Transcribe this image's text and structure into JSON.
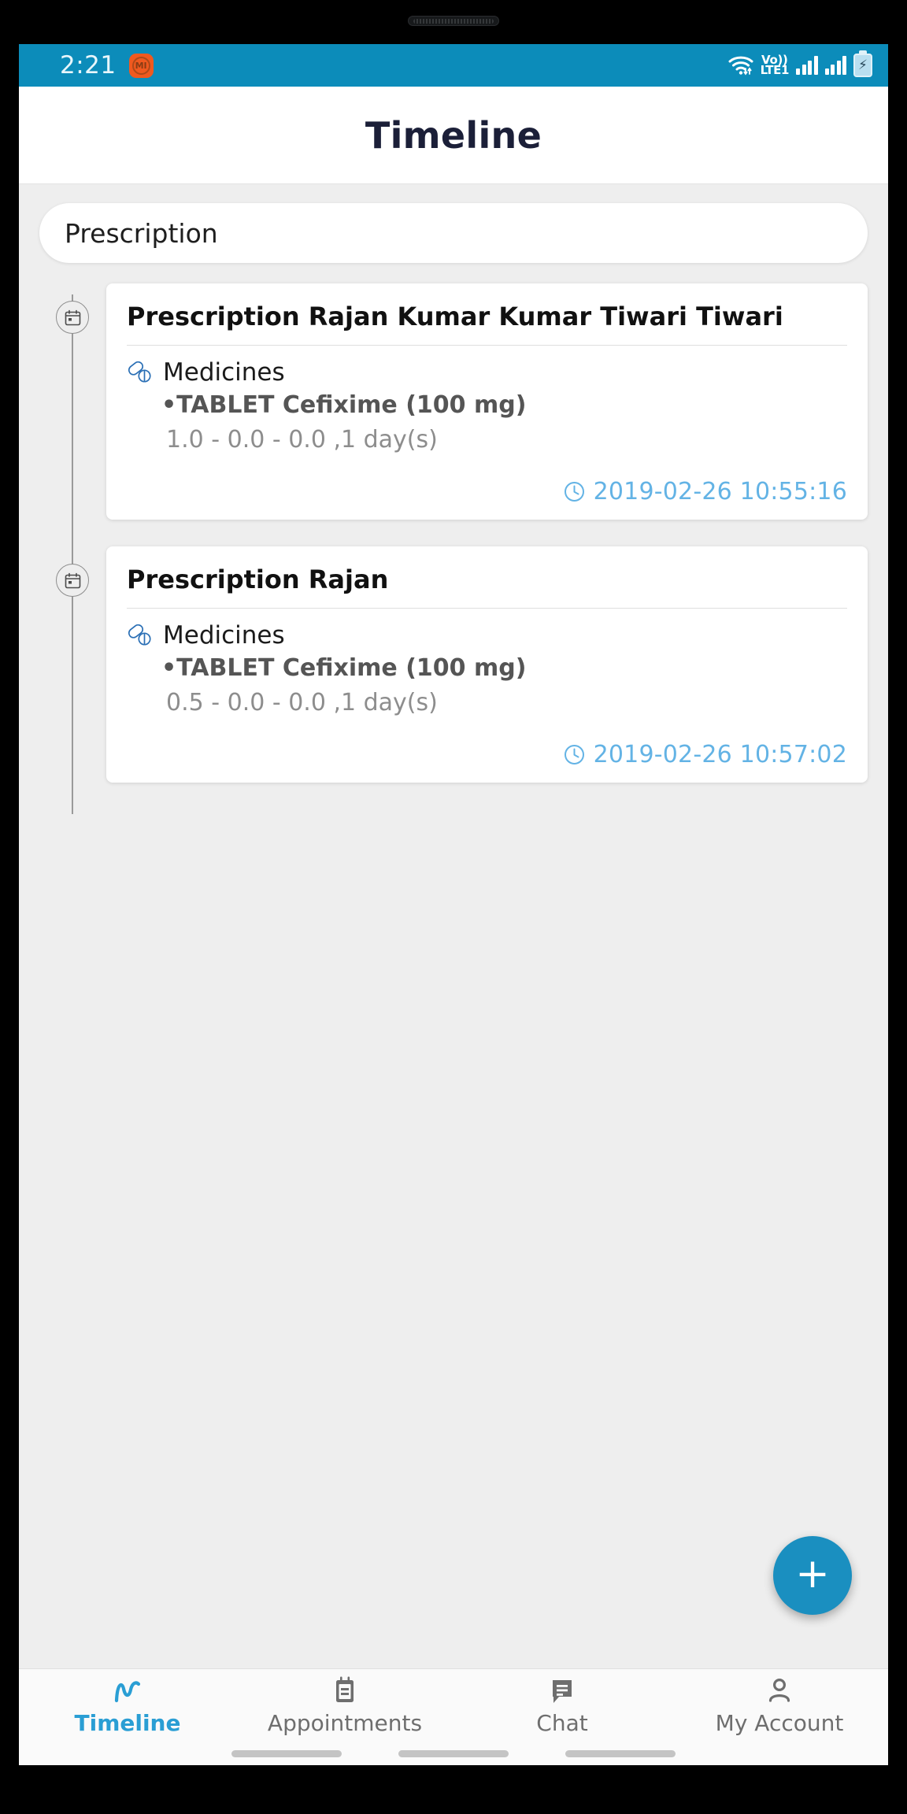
{
  "status_bar": {
    "time": "2:21",
    "app_icon_label": "MI",
    "network_vo_label": "Vo))",
    "network_lte_label": "LTE1",
    "icons": [
      "wifi-icon",
      "volte-icon",
      "signal-bars-icon",
      "signal-bars-icon",
      "battery-charging-icon"
    ],
    "background_color": "#0c8cba"
  },
  "app_bar": {
    "title": "Timeline",
    "title_color": "#1b1f38"
  },
  "filter": {
    "selected_label": "Prescription"
  },
  "timeline": {
    "marker_icon": "calendar-icon",
    "cards": [
      {
        "title": "Prescription Rajan Kumar Kumar Tiwari Tiwari",
        "section_icon": "pills-icon",
        "section_label": "Medicines",
        "medicine": "•TABLET Cefixime (100 mg)",
        "dosage": "1.0 - 0.0 - 0.0 ,1 day(s)",
        "time_icon": "clock-icon",
        "timestamp": "2019-02-26 10:55:16"
      },
      {
        "title": "Prescription Rajan",
        "section_icon": "pills-icon",
        "section_label": "Medicines",
        "medicine": "•TABLET Cefixime (100 mg)",
        "dosage": "0.5 - 0.0 - 0.0 ,1 day(s)",
        "time_icon": "clock-icon",
        "timestamp": "2019-02-26 10:57:02"
      }
    ]
  },
  "fab": {
    "label": "+",
    "color": "#1a8fc0"
  },
  "bottom_nav": {
    "active_color": "#2a9ed4",
    "inactive_color": "#6e6e6e",
    "items": [
      {
        "label": "Timeline",
        "icon": "timeline-chart-icon",
        "active": true
      },
      {
        "label": "Appointments",
        "icon": "calendar-device-icon",
        "active": false
      },
      {
        "label": "Chat",
        "icon": "chat-bubble-icon",
        "active": false
      },
      {
        "label": "My Account",
        "icon": "person-icon",
        "active": false
      }
    ]
  }
}
